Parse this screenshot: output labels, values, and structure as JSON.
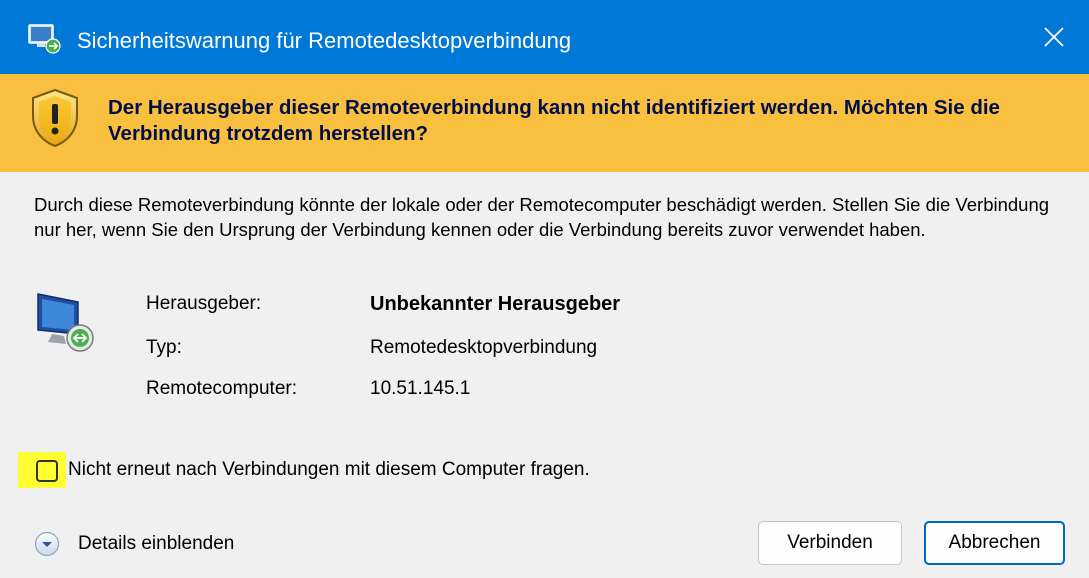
{
  "window": {
    "title": "Sicherheitswarnung für Remotedesktopverbindung",
    "title_bar_color": "#0078d7",
    "icon": "remote-desktop-app-icon",
    "close_icon": "close-icon"
  },
  "warning": {
    "text": "Der Herausgeber dieser Remoteverbindung kann nicht identifiziert werden. Möchten Sie die Verbindung trotzdem herstellen?",
    "band_color": "#f9bf3f",
    "icon": "shield-warning-icon"
  },
  "description": "Durch diese Remoteverbindung könnte der lokale oder der Remotecomputer beschädigt werden. Stellen Sie die Verbindung nur her, wenn Sie den Ursprung der Verbindung kennen oder die Verbindung bereits zuvor verwendet haben.",
  "info": {
    "icon": "remote-monitor-icon",
    "rows": [
      {
        "label": "Herausgeber:",
        "value": "Unbekannter Herausgeber"
      },
      {
        "label": "Typ:",
        "value": "Remotedesktopverbindung"
      },
      {
        "label": "Remotecomputer:",
        "value": "10.51.145.1"
      }
    ]
  },
  "checkbox": {
    "label": "Nicht erneut nach Verbindungen mit diesem Computer fragen.",
    "checked": false,
    "highlight_color": "#ffff33"
  },
  "details": {
    "label": "Details einblenden",
    "icon": "chevron-down-circle-icon"
  },
  "buttons": {
    "connect": "Verbinden",
    "cancel": "Abbrechen"
  }
}
